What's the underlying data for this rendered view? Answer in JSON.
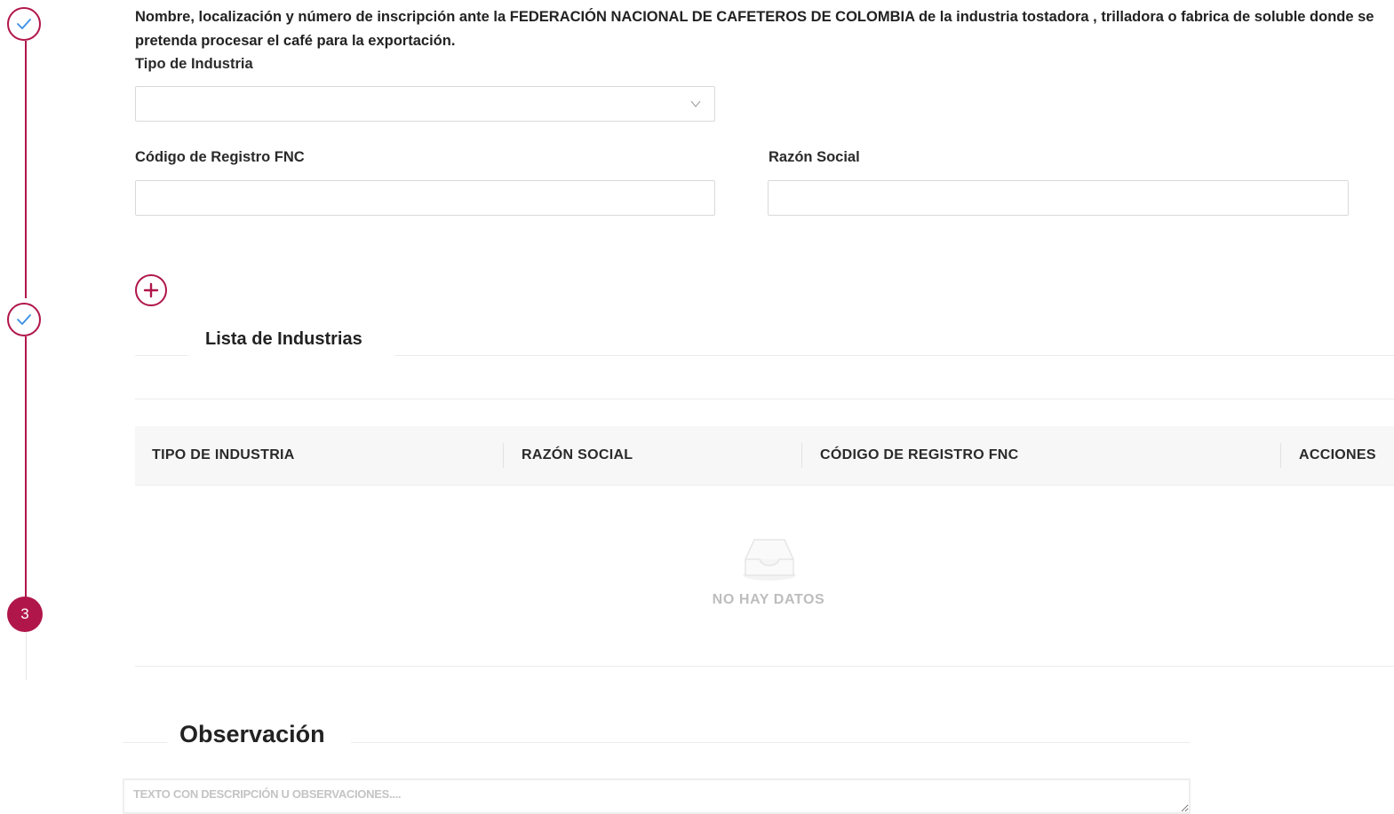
{
  "stepper": {
    "steps": [
      {
        "state": "completed",
        "icon": "check-icon"
      },
      {
        "state": "completed",
        "icon": "check-icon"
      },
      {
        "state": "current",
        "number": "3"
      }
    ],
    "accent_color": "#b0164a"
  },
  "form": {
    "instructions": "Nombre, localización y número de inscripción ante la FEDERACIÓN NACIONAL DE CAFETEROS DE COLOMBIA de la industria tostadora , trilladora o fabrica de soluble donde se pretenda procesar el café para la exportación.",
    "tipo_industria": {
      "label": "Tipo de Industria",
      "value": ""
    },
    "codigo_registro": {
      "label": "Código de Registro FNC",
      "value": ""
    },
    "razon_social": {
      "label": "Razón Social",
      "value": ""
    },
    "add_icon": "plus-circle-icon"
  },
  "industries": {
    "title": "Lista de Industrias",
    "columns": [
      "TIPO DE INDUSTRIA",
      "RAZÓN SOCIAL",
      "CÓDIGO DE REGISTRO FNC",
      "ACCIONES"
    ],
    "rows": [],
    "empty_text": "NO HAY DATOS",
    "empty_icon": "empty-inbox-icon"
  },
  "observation": {
    "title": "Observación",
    "placeholder": "TEXTO CON DESCRIPCIÓN U OBSERVACIONES....",
    "value": ""
  }
}
